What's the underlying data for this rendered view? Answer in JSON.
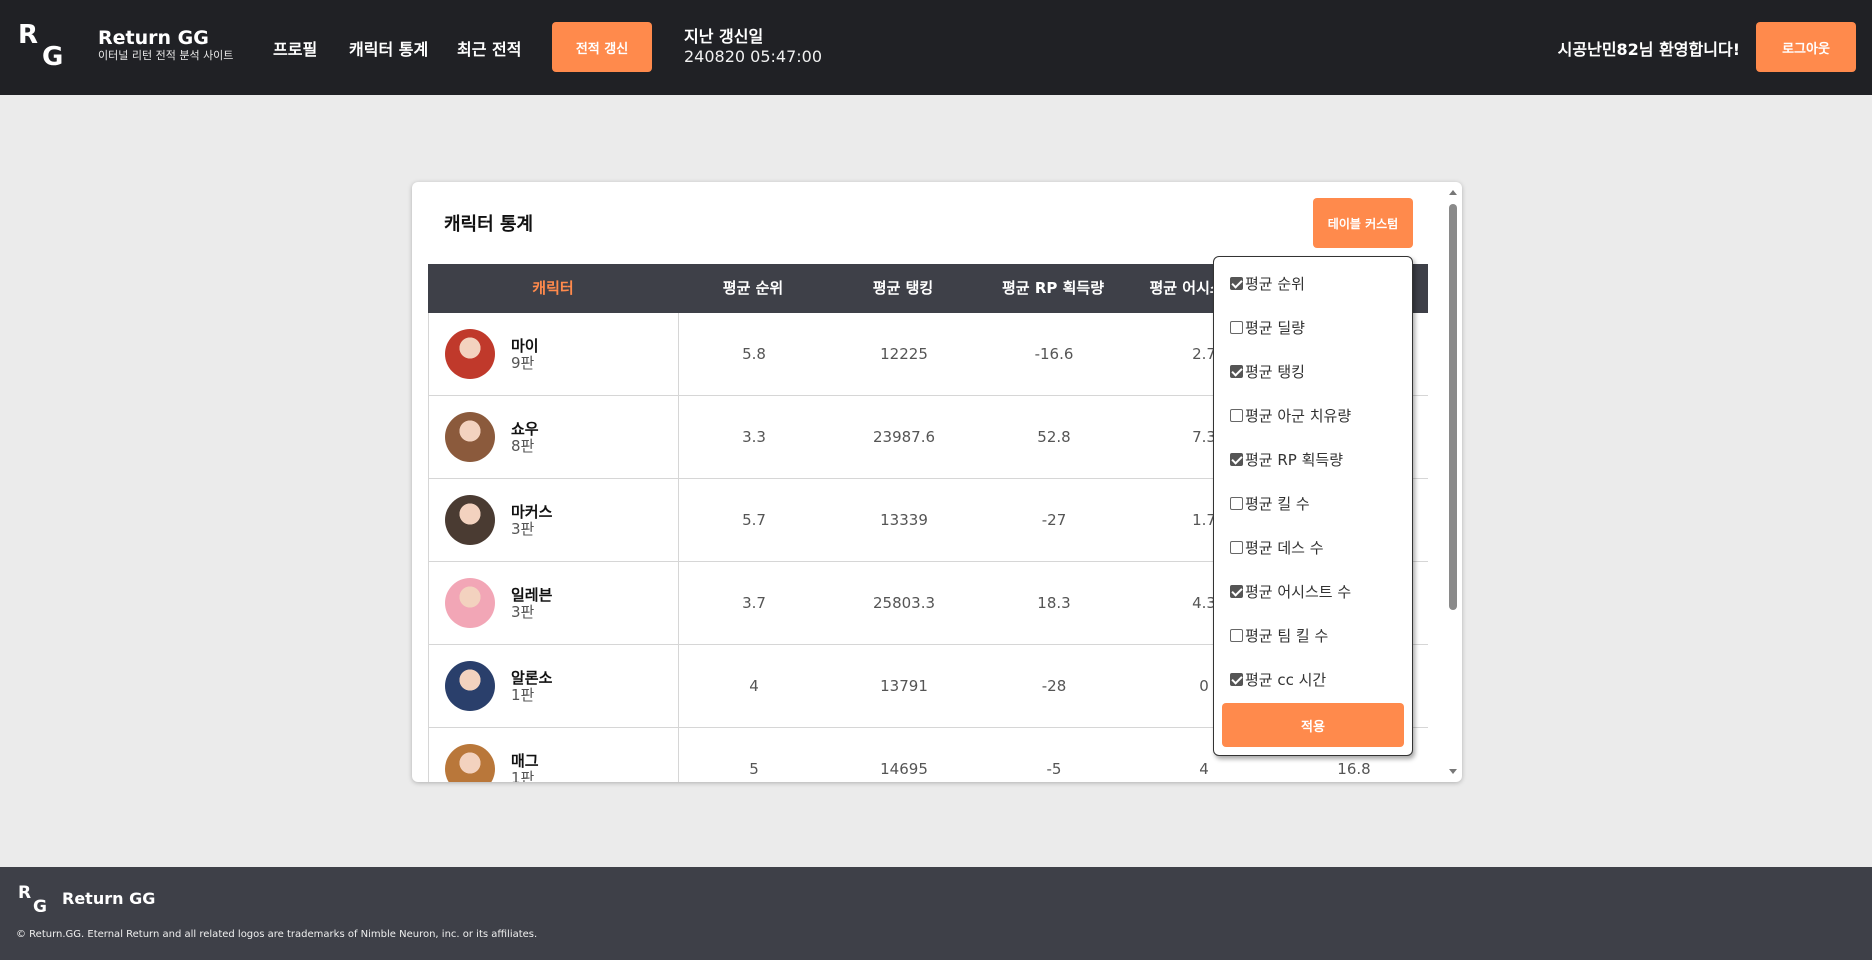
{
  "header": {
    "logo_r": "R",
    "logo_g": "G",
    "brand_title": "Return GG",
    "brand_sub": "이터널 리턴 전적 분석 사이트",
    "nav": [
      "프로필",
      "캐릭터 통계",
      "최근 전적"
    ],
    "refresh_label": "전적 갱신",
    "last_update_label": "지난 갱신일",
    "last_update_value": "240820 05:47:00",
    "welcome": "시공난민82님 환영합니다!",
    "logout_label": "로그아웃"
  },
  "card": {
    "title": "캐릭터 통계",
    "custom_button": "테이블 커스텀"
  },
  "table": {
    "columns": [
      "캐릭터",
      "평균 순위",
      "평균 탱킹",
      "평균 RP 획득량",
      "평균 어시스트 수",
      ""
    ],
    "rows": [
      {
        "name": "마이",
        "games": "9판",
        "rank": "5.8",
        "tanking": "12225",
        "rp": "-16.6",
        "assist": "2.7",
        "cc": ""
      },
      {
        "name": "쇼우",
        "games": "8판",
        "rank": "3.3",
        "tanking": "23987.6",
        "rp": "52.8",
        "assist": "7.3",
        "cc": ""
      },
      {
        "name": "마커스",
        "games": "3판",
        "rank": "5.7",
        "tanking": "13339",
        "rp": "-27",
        "assist": "1.7",
        "cc": ""
      },
      {
        "name": "일레븐",
        "games": "3판",
        "rank": "3.7",
        "tanking": "25803.3",
        "rp": "18.3",
        "assist": "4.3",
        "cc": ""
      },
      {
        "name": "알론소",
        "games": "1판",
        "rank": "4",
        "tanking": "13791",
        "rp": "-28",
        "assist": "0",
        "cc": ""
      },
      {
        "name": "매그",
        "games": "1판",
        "rank": "5",
        "tanking": "14695",
        "rp": "-5",
        "assist": "4",
        "cc": "16.8"
      }
    ],
    "avatar_colors": [
      "#c0392b",
      "#8b5a3c",
      "#4a3b32",
      "#f2a6b6",
      "#2a3f6b",
      "#b9773a"
    ]
  },
  "dropdown": {
    "options": [
      {
        "label": "평균 순위",
        "checked": true
      },
      {
        "label": "평균 딜량",
        "checked": false
      },
      {
        "label": "평균 탱킹",
        "checked": true
      },
      {
        "label": "평균 아군 치유량",
        "checked": false
      },
      {
        "label": "평균 RP 획득량",
        "checked": true
      },
      {
        "label": "평균 킬 수",
        "checked": false
      },
      {
        "label": "평균 데스 수",
        "checked": false
      },
      {
        "label": "평균 어시스트 수",
        "checked": true
      },
      {
        "label": "평균 팀 킬 수",
        "checked": false
      },
      {
        "label": "평균 cc 시간",
        "checked": true
      }
    ],
    "apply_label": "적용"
  },
  "footer": {
    "brand": "Return GG",
    "copyright": "© Return.GG. Eternal Return and all related logos are trademarks of Nimble Neuron, inc. or its affiliates."
  },
  "colors": {
    "accent": "#ff8a4c",
    "header_bg": "#202125",
    "table_head_bg": "#3e4048",
    "footer_bg": "#3e4048",
    "page_bg": "#ebebeb"
  }
}
